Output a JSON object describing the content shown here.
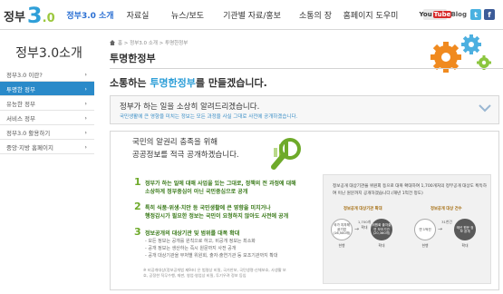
{
  "header": {
    "logo_prefix": "정부",
    "logo_three": "3",
    "logo_zero": ".0",
    "nav": [
      "정부3.0 소개",
      "자료실",
      "뉴스/보도",
      "기관별 자료/홍보",
      "소통의 장",
      "홈페이지 도우미"
    ],
    "youtube_label": "You",
    "youtube_tube": "Tube",
    "blog_label": "Blog",
    "twitter_icon": "twitter-icon",
    "facebook_icon": "facebook-icon",
    "twitter_color": "#4ab1e0",
    "facebook_color": "#3b5b98"
  },
  "sidebar": {
    "title": "정부3.0소개",
    "items": [
      {
        "label": "정부3.0 이란?",
        "active": false
      },
      {
        "label": "투명한 정부",
        "active": true
      },
      {
        "label": "유능한 정부",
        "active": false
      },
      {
        "label": "서비스 정부",
        "active": false
      },
      {
        "label": "정부3.0 활용하기",
        "active": false
      },
      {
        "label": "중앙·지방 홈페이지",
        "active": false
      }
    ],
    "chevron": "›"
  },
  "breadcrumb": "홈 > 정부3.0 소개 > 투명한정부",
  "page_title": "투명한정부",
  "intro": {
    "before": "소통하는 ",
    "highlight": "투명한정부",
    "after": "를 만들겠습니다."
  },
  "notice": {
    "title": "정부가 하는 일을 소상히 알려드리겠습니다.",
    "subtitle": "국민생활에 큰 영향을 미치는 정보는 모든 과정을 사실 그대로 사전에 공개하겠습니다."
  },
  "panel": {
    "heading_line1": "국민의 알권리 충족을 위해",
    "heading_line2": "공공정보를 적극 공개하겠습니다.",
    "points": [
      {
        "num": "1",
        "line1": "정부가 하는 일에 대해 사업을 있는 그대로, 정책의 전 과정에 대해",
        "line2": "소상하게 정부중심이 아닌 국민중심으로 공개"
      },
      {
        "num": "2",
        "line1": "특히 식품·위생·치안 등 국민생활에 큰 영향을 미치거나",
        "line2": "행정감시가 필요한 정보는 국민이 요청하지 않아도 사전에 공개"
      },
      {
        "num": "3",
        "line1": "정보공개의 대상기관 및 범위를 대폭 확대"
      }
    ],
    "sub_points": [
      "- 모든 정보는 공개를 원칙으로 하고, 비공개 정보는 최소화",
      "- 공개 정보는 생산하는 즉시 원문까지 사전 공개",
      "- 공개 대상기관을 부처별 위원회, 출자·출연기관 등 보조기관까지 확대"
    ],
    "note": "※ 비공개대상(정보공개법 제9조) 은 법령상 비밀, 국가안보, 국민생명·신체보호, 사생활 보호, 공정한 직무수행, 재판, 영업·영업상 비밀, 투기우려 정보 등임",
    "box": {
      "text": "정보공개 대상기관을 위원회 등으로 대폭 확대하여 1,700개처의 정부공개 대상도 획득하여 이닌 원문까지 공개하겠습니다.(해년 1억건 정도)",
      "label_left": "정보공개 대상기관 확대",
      "label_right": "정보공개 대상 건수",
      "circles": [
        {
          "text": "국가 지자체 공기업 (16,500개)",
          "dark": false,
          "tag": "현행"
        },
        {
          "text": "위원회 출자출연 보조기관 (20,360개)",
          "dark": true,
          "tag": "확대"
        },
        {
          "text": "연 1억건",
          "dark": false,
          "tag": "현행"
        },
        {
          "text": "매년 원문 정보 공개",
          "dark": true,
          "tag": "확대"
        }
      ],
      "arrow_label_1": "1,700개 확대",
      "arrow_label_2": "31천건"
    }
  },
  "colors": {
    "accent": "#2f9fd8",
    "active_side": "#2a8ac9",
    "green": "#6eaa2a"
  }
}
